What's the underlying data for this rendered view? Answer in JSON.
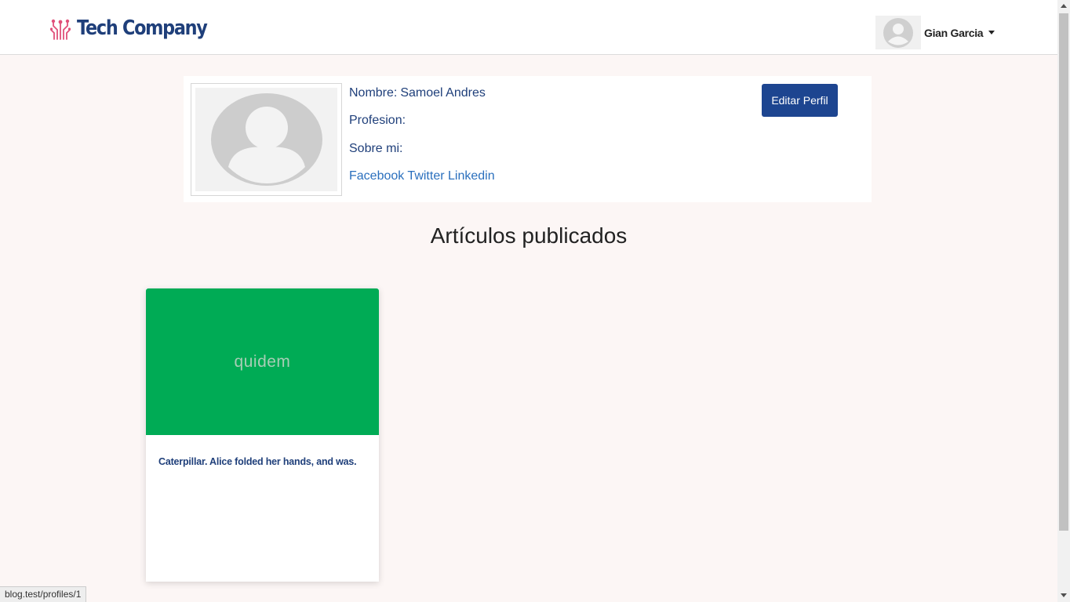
{
  "navbar": {
    "brand": "Tech Company",
    "user_name": "Gian Garcia"
  },
  "profile": {
    "name_label": "Nombre:",
    "name_value": "Samoel Andres",
    "profession_label": "Profesion:",
    "profession_value": "",
    "about_label": "Sobre mi:",
    "about_value": "",
    "social": {
      "facebook": "Facebook",
      "twitter": "Twitter",
      "linkedin": "Linkedin"
    },
    "edit_button": "Editar Perfil"
  },
  "articles_section": {
    "title": "Artículos publicados",
    "items": [
      {
        "thumb_text": "quidem",
        "thumb_color": "#00ab55",
        "excerpt": "Caterpillar. Alice folded her hands, and was."
      }
    ]
  },
  "status_bar": {
    "url": "blog.test/profiles/1"
  },
  "colors": {
    "brand": "#1f3f7a",
    "accent_logo": "#e0507a",
    "button": "#1d4590",
    "link": "#2a6fbd",
    "page_bg": "#fcf6f5"
  },
  "icons": {
    "logo": "circuit-logo-icon",
    "avatar": "user-placeholder-icon",
    "caret": "caret-down-icon"
  }
}
